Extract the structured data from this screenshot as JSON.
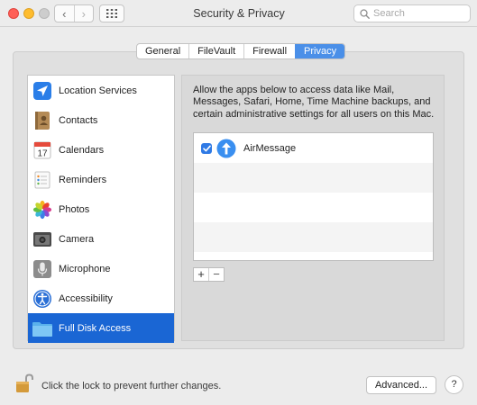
{
  "window": {
    "title": "Security & Privacy",
    "back_glyph": "‹",
    "forward_glyph": "›",
    "grid_icon": "grid-icon"
  },
  "search": {
    "placeholder": "Search",
    "value": ""
  },
  "tabs": [
    {
      "label": "General",
      "active": false
    },
    {
      "label": "FileVault",
      "active": false
    },
    {
      "label": "Firewall",
      "active": false
    },
    {
      "label": "Privacy",
      "active": true
    }
  ],
  "sidebar": {
    "items": [
      {
        "label": "Location Services",
        "icon": "location-arrow-icon",
        "selected": false
      },
      {
        "label": "Contacts",
        "icon": "contacts-book-icon",
        "selected": false
      },
      {
        "label": "Calendars",
        "icon": "calendar-icon",
        "selected": false
      },
      {
        "label": "Reminders",
        "icon": "reminders-list-icon",
        "selected": false
      },
      {
        "label": "Photos",
        "icon": "photos-flower-icon",
        "selected": false
      },
      {
        "label": "Camera",
        "icon": "camera-icon",
        "selected": false
      },
      {
        "label": "Microphone",
        "icon": "microphone-icon",
        "selected": false
      },
      {
        "label": "Accessibility",
        "icon": "accessibility-icon",
        "selected": false
      },
      {
        "label": "Full Disk Access",
        "icon": "folder-icon",
        "selected": true
      }
    ],
    "calendar_day": "17"
  },
  "panel": {
    "description": "Allow the apps below to access data like Mail, Messages, Safari, Home, Time Machine backups, and certain administrative settings for all users on this Mac.",
    "apps": [
      {
        "name": "AirMessage",
        "checked": true,
        "icon": "airmessage-arrow-icon"
      }
    ],
    "add_label": "+",
    "remove_label": "−"
  },
  "footer": {
    "lock_text": "Click the lock to prevent further changes.",
    "advanced_label": "Advanced...",
    "help_label": "?"
  },
  "colors": {
    "selection": "#1a66d4",
    "tab_active": "#4a8fe8",
    "checkbox": "#2f7ae5",
    "close": "#ff5f57",
    "minimize": "#febc2e"
  }
}
